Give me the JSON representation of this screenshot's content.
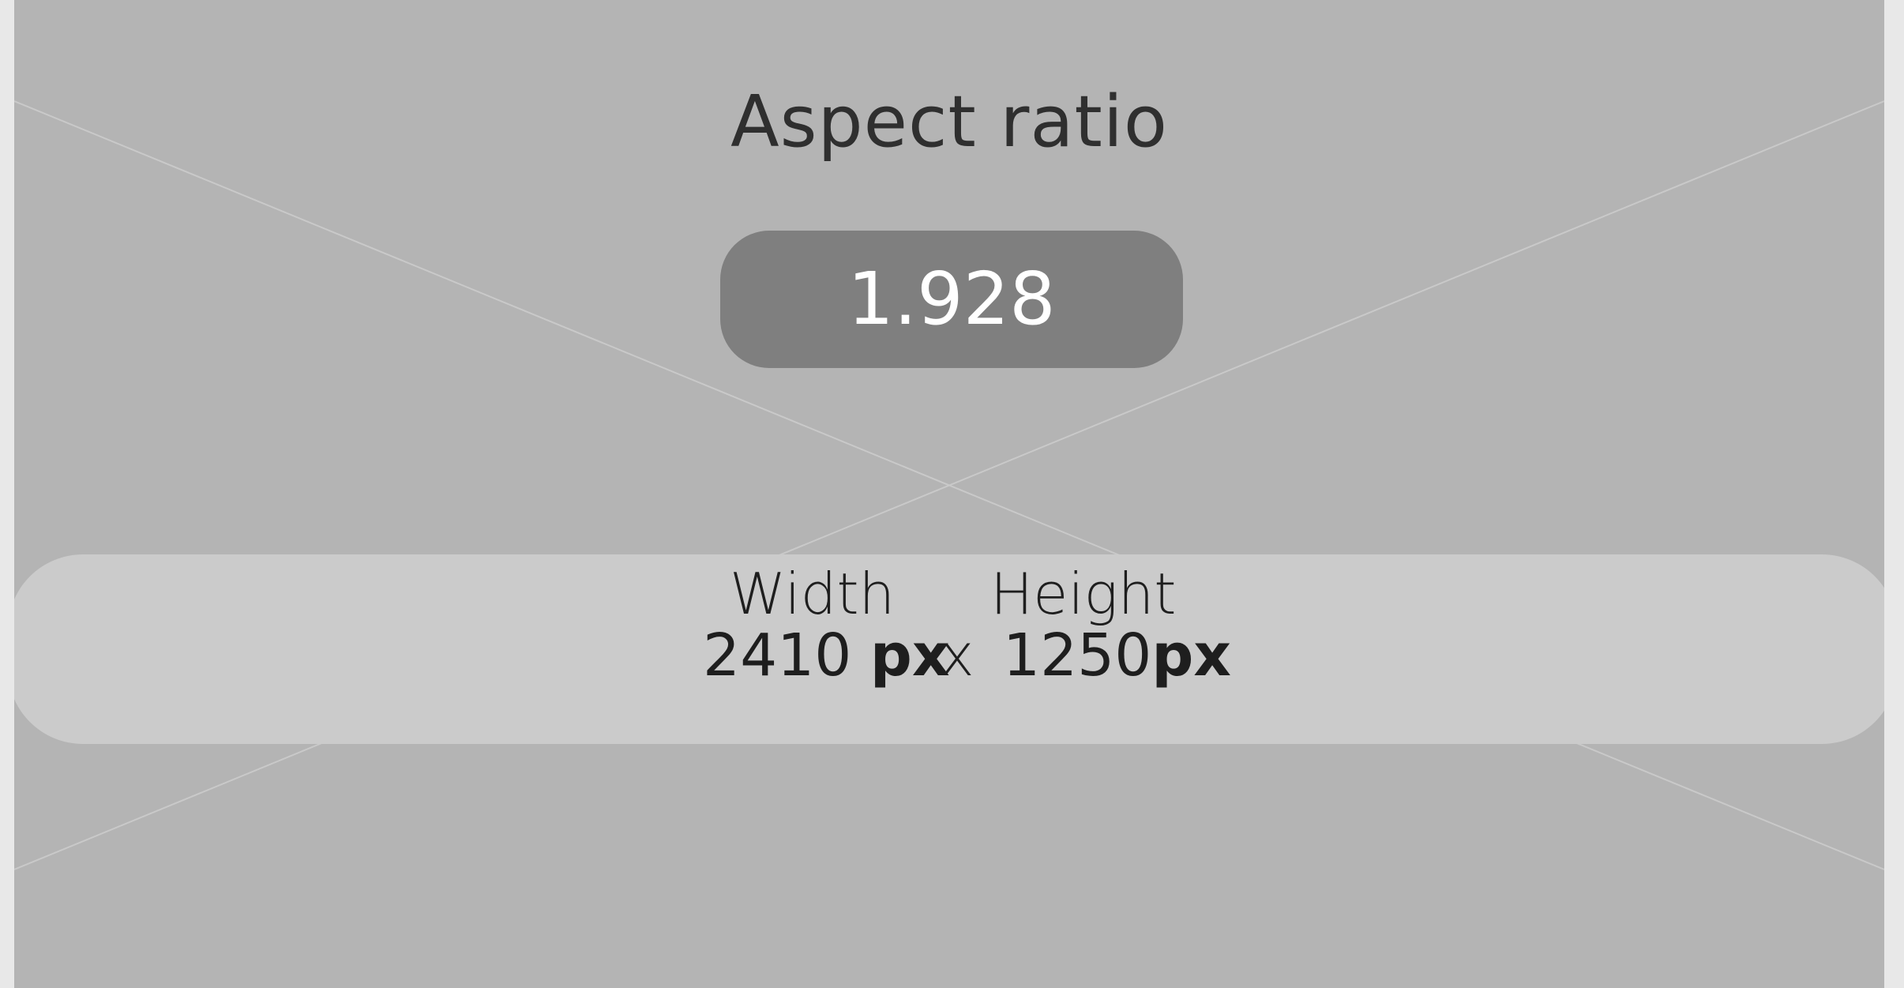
{
  "title": "Aspect ratio",
  "ratio": "1.928",
  "width_label": "Width",
  "height_label": "Height",
  "width_value": "2410",
  "width_unit": "px",
  "times_symbol": "x",
  "height_value": "1250",
  "height_unit": "px",
  "colors": {
    "background": "#b4b4b4",
    "pill": "#7f7f7f",
    "band": "#cbcbcb"
  }
}
